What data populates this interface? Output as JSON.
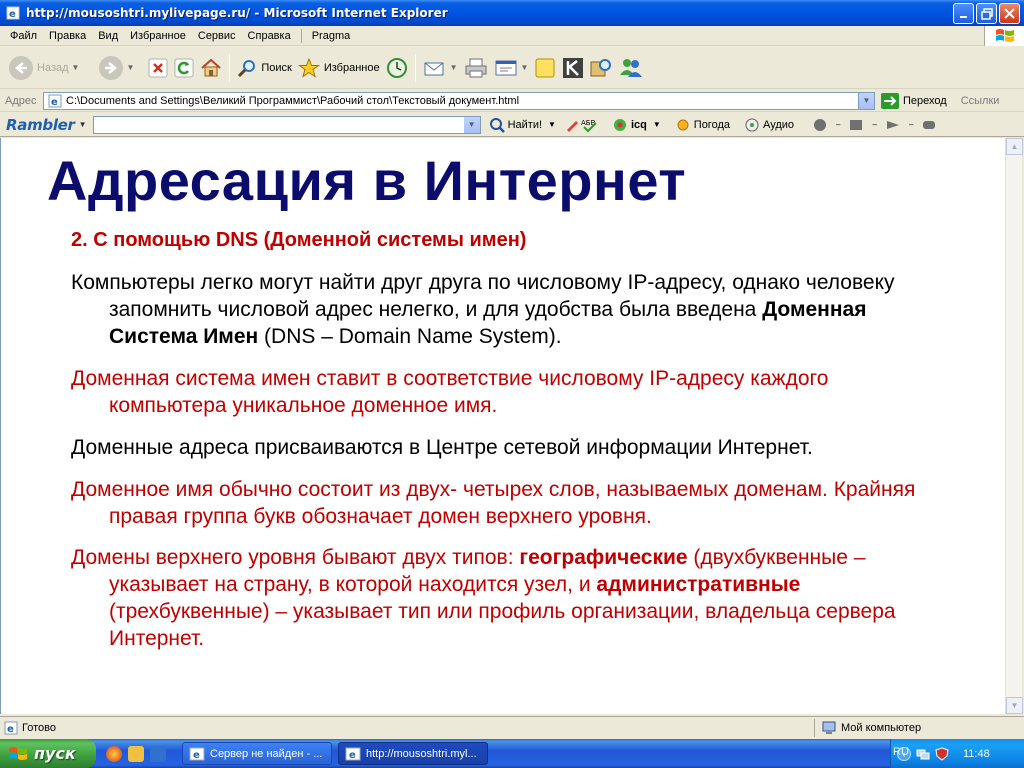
{
  "window": {
    "title": "http://mousoshtri.mylivepage.ru/ - Microsoft Internet Explorer"
  },
  "menu": [
    "Файл",
    "Правка",
    "Вид",
    "Избранное",
    "Сервис",
    "Справка",
    "Pragma"
  ],
  "toolbar": {
    "back_label": "Назад",
    "search_label": "Поиск",
    "favorites_label": "Избранное"
  },
  "address": {
    "label": "Адрес",
    "url": "C:\\Documents and Settings\\Великий Программист\\Рабочий стол\\Текстовый документ.html",
    "go_label": "Переход",
    "links_label": "Ссылки"
  },
  "rambler": {
    "logo": "Rambler",
    "search_value": "",
    "find_label": "Найти!",
    "icq_label": "icq",
    "weather_label": "Погода",
    "audio_label": "Аудио"
  },
  "slide": {
    "title": "Адресация в Интернет",
    "subheading": "2. С помощью DNS (Доменной системы имен)",
    "p1_a": "Компьютеры легко могут найти друг друга по числовому IP-адресу, однако человеку запомнить числовой адрес нелегко, и для удобства была введена ",
    "p1_b": "Доменная Система Имен",
    "p1_c": " (DNS – Domain Name System).",
    "p2": "Доменная система имен ставит в соответствие числовому IP-адресу каждого компьютера уникальное доменное имя.",
    "p3": "Доменные адреса присваиваются в Центре сетевой информации Интернет.",
    "p4": "Доменное имя обычно состоит из двух- четырех слов, называемых доменам. Крайняя правая группа букв обозначает домен верхнего уровня.",
    "p5_a": "Домены верхнего уровня бывают двух типов: ",
    "p5_b": "географические",
    "p5_c": " (двухбуквенные – указывает на страну, в которой находится узел, и ",
    "p5_d": "административные",
    "p5_e": " (трехбуквенные) – указывает тип или профиль организации, владельца сервера Интернет."
  },
  "status": {
    "text": "Готово",
    "zone": "Мой компьютер"
  },
  "taskbar": {
    "start_label": "пуск",
    "tasks": [
      "Сервер не найден - ...",
      "http://mousoshtri.myl..."
    ],
    "lang": "RU",
    "clock": "11:48"
  },
  "colors": {
    "title_blue": "#0c0c6c",
    "accent_red": "#c00000"
  }
}
